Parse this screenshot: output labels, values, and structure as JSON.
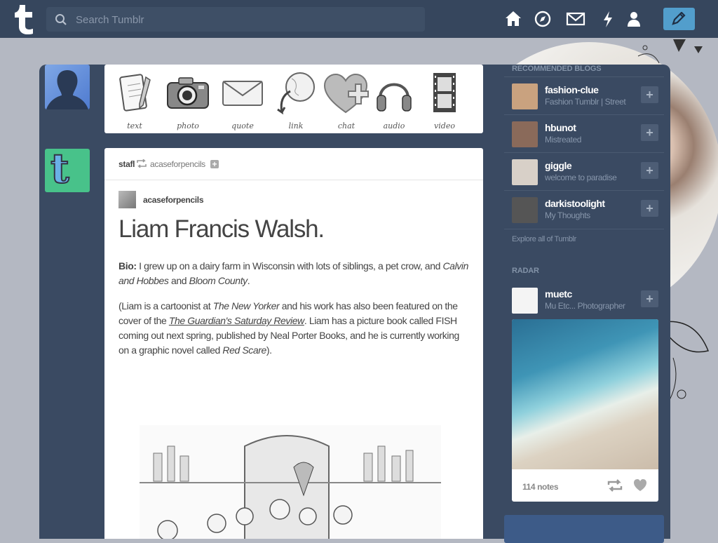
{
  "header": {
    "search_placeholder": "Search Tumblr",
    "nav": [
      "home-icon",
      "explore-compass-icon",
      "inbox-envelope-icon",
      "activity-lightning-icon",
      "account-person-icon"
    ],
    "accent_color": "#529ecc",
    "bar_color": "#36465d"
  },
  "post_types": [
    {
      "label": "text",
      "icon": "text-notepad-icon"
    },
    {
      "label": "photo",
      "icon": "camera-icon"
    },
    {
      "label": "quote",
      "icon": "envelope-quote-icon"
    },
    {
      "label": "link",
      "icon": "globe-link-icon"
    },
    {
      "label": "chat",
      "icon": "heart-plus-icon"
    },
    {
      "label": "audio",
      "icon": "headphones-icon"
    },
    {
      "label": "video",
      "icon": "film-strip-icon"
    }
  ],
  "post": {
    "poster": "stafl",
    "reblogged_from": "acaseforpencils",
    "source_blog": "acaseforpencils",
    "title": "Liam Francis Walsh.",
    "bio_label": "Bio:",
    "bio_text": " I grew up on a dairy farm in Wisconsin with lots of siblings, a pet crow, and ",
    "bio_em1": "Calvin and Hobbes",
    "bio_and": " and ",
    "bio_em2": "Bloom County",
    "bio_end": ".",
    "p2_a": "(Liam is a cartoonist at ",
    "p2_em1": "The New Yorker",
    "p2_b": " and his work has also been featured on the cover of the ",
    "p2_link": "The Guardian's Saturday Review",
    "p2_c": ". Liam has a picture book called FISH coming out next spring, published by Neal Porter Books, and he is currently working on a graphic novel called ",
    "p2_em2": "Red Scare",
    "p2_d": ")."
  },
  "sidebar": {
    "recommended_title": "Recommended Blogs",
    "recommended": [
      {
        "name": "fashion-clue",
        "desc": "Fashion Tumblr | Street",
        "color": "#c9a27f"
      },
      {
        "name": "hbunot",
        "desc": "Mistreated",
        "color": "#8a6a5a"
      },
      {
        "name": "giggle",
        "desc": "welcome to paradise",
        "color": "#d8d0c8"
      },
      {
        "name": "darkistoolight",
        "desc": "My Thoughts",
        "color": "#555555"
      }
    ],
    "explore_label": "Explore all of Tumblr",
    "radar_title": "Radar",
    "radar": {
      "name": "muetc",
      "desc": "Mu Etc... Photographer",
      "notes": "114 notes"
    }
  }
}
